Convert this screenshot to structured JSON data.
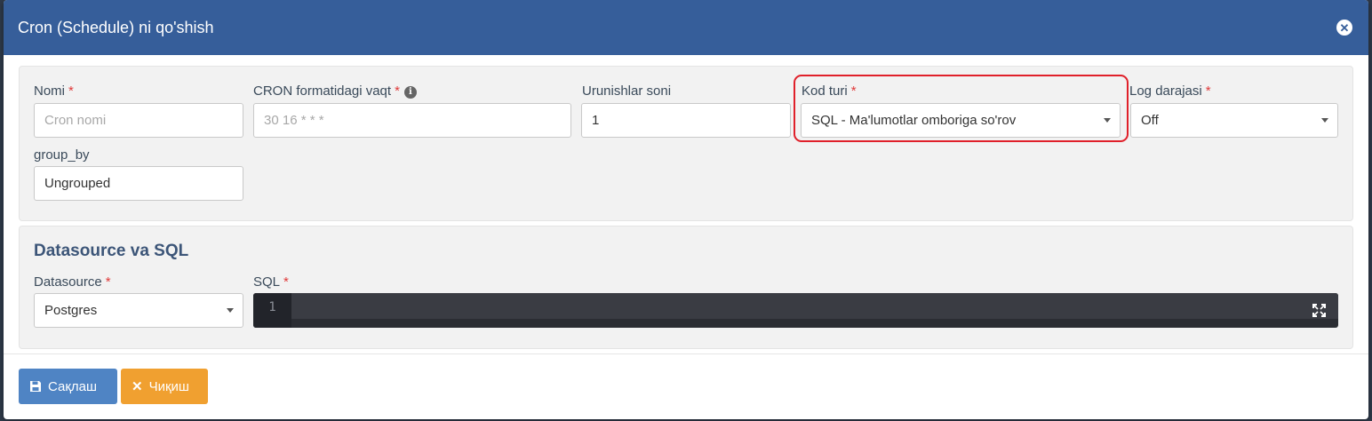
{
  "modal": {
    "title": "Cron (Schedule) ni qo'shish"
  },
  "form": {
    "name": {
      "label": "Nomi",
      "required": "*",
      "value": "",
      "placeholder": "Cron nomi"
    },
    "cron": {
      "label": "CRON formatidagi vaqt",
      "required": "*",
      "value": "",
      "placeholder": "30 16 * * *",
      "info_icon": "i"
    },
    "attempts": {
      "label": "Urunishlar soni",
      "value": "1"
    },
    "code_type": {
      "label": "Kod turi",
      "required": "*",
      "value": "SQL - Ma'lumotlar omboriga so'rov"
    },
    "log_level": {
      "label": "Log darajasi",
      "required": "*",
      "value": "Off"
    },
    "group_by": {
      "label": "group_by",
      "value": "Ungrouped"
    }
  },
  "datasource_section": {
    "title": "Datasource va SQL",
    "datasource": {
      "label": "Datasource",
      "required": "*",
      "value": "Postgres"
    },
    "sql": {
      "label": "SQL",
      "required": "*",
      "line_number": "1"
    }
  },
  "footer": {
    "save_label": "Сақлаш",
    "exit_label": "Чиқиш"
  },
  "colors": {
    "header": "#365e9a",
    "save_button": "#4f84c4",
    "exit_button": "#f0a030",
    "required": "#e03a3a",
    "highlight": "#e0202a"
  }
}
